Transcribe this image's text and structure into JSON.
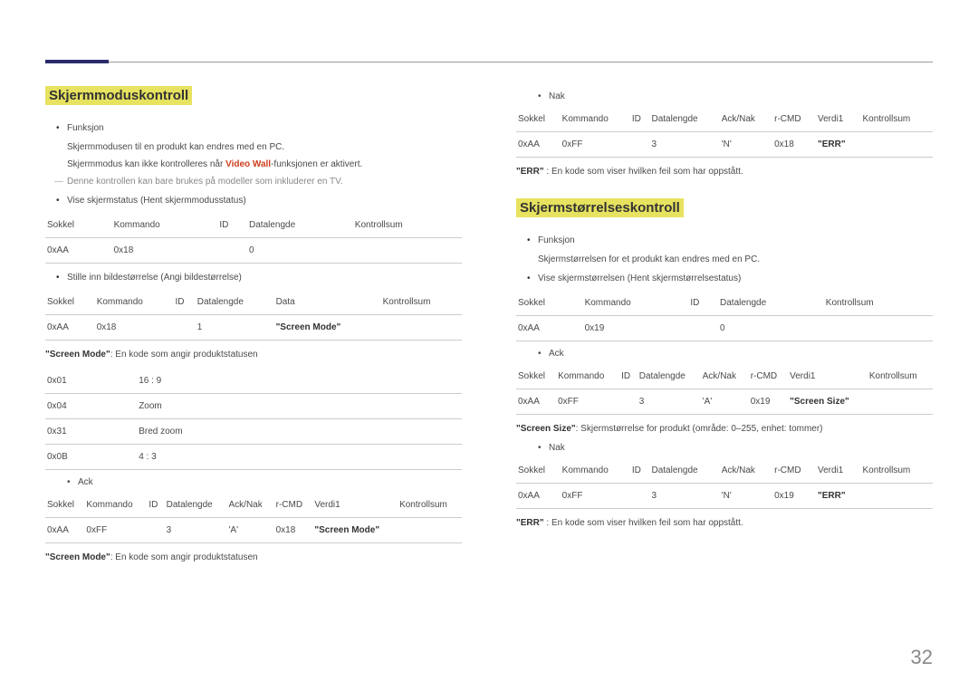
{
  "pageNumber": "32",
  "left": {
    "title": "Skjermmoduskontroll",
    "func_label": "Funksjon",
    "func_line1": "Skjermmodusen til en produkt kan endres med en PC.",
    "func_line2_a": "Skjermmodus kan ikke kontrolleres når ",
    "func_line2_em": "Video Wall",
    "func_line2_b": "-funksjonen er aktivert.",
    "note": "Denne kontrollen kan bare brukes på modeller som inkluderer en TV.",
    "view_label": "Vise skjermstatus (Hent skjermmodusstatus)",
    "t1": {
      "h": [
        "Sokkel",
        "Kommando",
        "ID",
        "Datalengde",
        "Kontrollsum"
      ],
      "r": [
        "0xAA",
        "0x18",
        "",
        "0",
        ""
      ]
    },
    "set_label": "Stille inn bildestørrelse (Angi bildestørrelse)",
    "t2": {
      "h": [
        "Sokkel",
        "Kommando",
        "ID",
        "Datalengde",
        "Data",
        "Kontrollsum"
      ],
      "r": [
        "0xAA",
        "0x18",
        "",
        "1",
        "\"Screen Mode\"",
        ""
      ]
    },
    "desc1_a": "\"Screen Mode\"",
    "desc1_b": ": En kode som angir produktstatusen",
    "modes": {
      "r1": [
        "0x01",
        "16 : 9"
      ],
      "r2": [
        "0x04",
        "Zoom"
      ],
      "r3": [
        "0x31",
        "Bred zoom"
      ],
      "r4": [
        "0x0B",
        "4 : 3"
      ]
    },
    "ack_label": "Ack",
    "t3": {
      "h": [
        "Sokkel",
        "Kommando",
        "ID",
        "Datalengde",
        "Ack/Nak",
        "r-CMD",
        "Verdi1",
        "Kontrollsum"
      ],
      "r": [
        "0xAA",
        "0xFF",
        "",
        "3",
        "'A'",
        "0x18",
        "\"Screen Mode\"",
        ""
      ]
    },
    "desc2_a": "\"Screen Mode\"",
    "desc2_b": ": En kode som angir produktstatusen"
  },
  "right": {
    "nak_label": "Nak",
    "t4": {
      "h": [
        "Sokkel",
        "Kommando",
        "ID",
        "Datalengde",
        "Ack/Nak",
        "r-CMD",
        "Verdi1",
        "Kontrollsum"
      ],
      "r": [
        "0xAA",
        "0xFF",
        "",
        "3",
        "'N'",
        "0x18",
        "\"ERR\"",
        ""
      ]
    },
    "err_a": "\"ERR\"",
    "err_b": " : En kode som viser hvilken feil som har oppstått.",
    "title": "Skjermstørrelseskontroll",
    "func_label": "Funksjon",
    "func_line1": "Skjermstørrelsen for et produkt kan endres med en PC.",
    "view_label": "Vise skjermstørrelsen (Hent skjermstørrelsestatus)",
    "t5": {
      "h": [
        "Sokkel",
        "Kommando",
        "ID",
        "Datalengde",
        "Kontrollsum"
      ],
      "r": [
        "0xAA",
        "0x19",
        "",
        "0",
        ""
      ]
    },
    "ack_label": "Ack",
    "t6": {
      "h": [
        "Sokkel",
        "Kommando",
        "ID",
        "Datalengde",
        "Ack/Nak",
        "r-CMD",
        "Verdi1",
        "Kontrollsum"
      ],
      "r": [
        "0xAA",
        "0xFF",
        "",
        "3",
        "'A'",
        "0x19",
        "\"Screen Size\"",
        ""
      ]
    },
    "size_a": "\"Screen Size\"",
    "size_b": ": Skjermstørrelse for produkt (område: 0–255, enhet: tommer)",
    "nak2_label": "Nak",
    "t7": {
      "h": [
        "Sokkel",
        "Kommando",
        "ID",
        "Datalengde",
        "Ack/Nak",
        "r-CMD",
        "Verdi1",
        "Kontrollsum"
      ],
      "r": [
        "0xAA",
        "0xFF",
        "",
        "3",
        "'N'",
        "0x19",
        "\"ERR\"",
        ""
      ]
    },
    "err2_a": "\"ERR\"",
    "err2_b": " : En kode som viser hvilken feil som har oppstått."
  }
}
